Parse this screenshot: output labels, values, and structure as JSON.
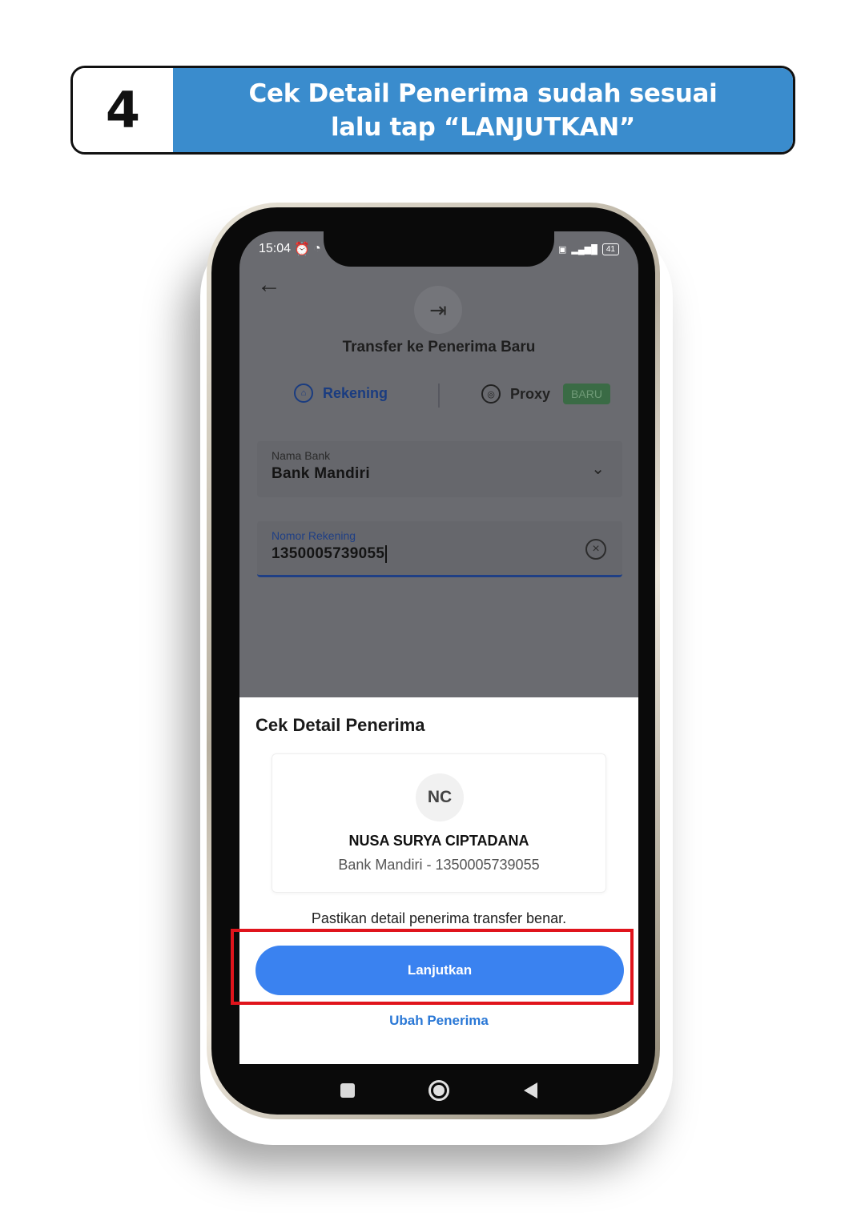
{
  "step": {
    "number": "4",
    "line1": "Cek Detail Penerima sudah sesuai",
    "line2": "lalu tap “LANJUTKAN”"
  },
  "status_bar": {
    "time": "15:04",
    "battery": "41"
  },
  "app": {
    "title": "Transfer ke Penerima Baru",
    "tabs": [
      {
        "label": "Rekening",
        "icon": "bank-account-icon",
        "active": true
      },
      {
        "label": "Proxy",
        "icon": "proxy-icon",
        "badge": "BARU",
        "active": false
      }
    ],
    "bank_field": {
      "label": "Nama Bank",
      "value": "Bank Mandiri"
    },
    "account_field": {
      "label": "Nomor Rekening",
      "value": "1350005739055"
    }
  },
  "sheet": {
    "title": "Cek Detail Penerima",
    "avatar_initials": "NC",
    "recipient_name": "NUSA SURYA CIPTADANA",
    "recipient_detail": "Bank Mandiri - 1350005739055",
    "confirm_text": "Pastikan detail penerima transfer benar.",
    "primary_button": "Lanjutkan",
    "secondary_button": "Ubah Penerima"
  },
  "colors": {
    "step_banner": "#3a8ccd",
    "primary_button": "#3a82f0",
    "link": "#2a78d6",
    "highlight": "#e0141c",
    "badge_green": "#3a6b45"
  }
}
